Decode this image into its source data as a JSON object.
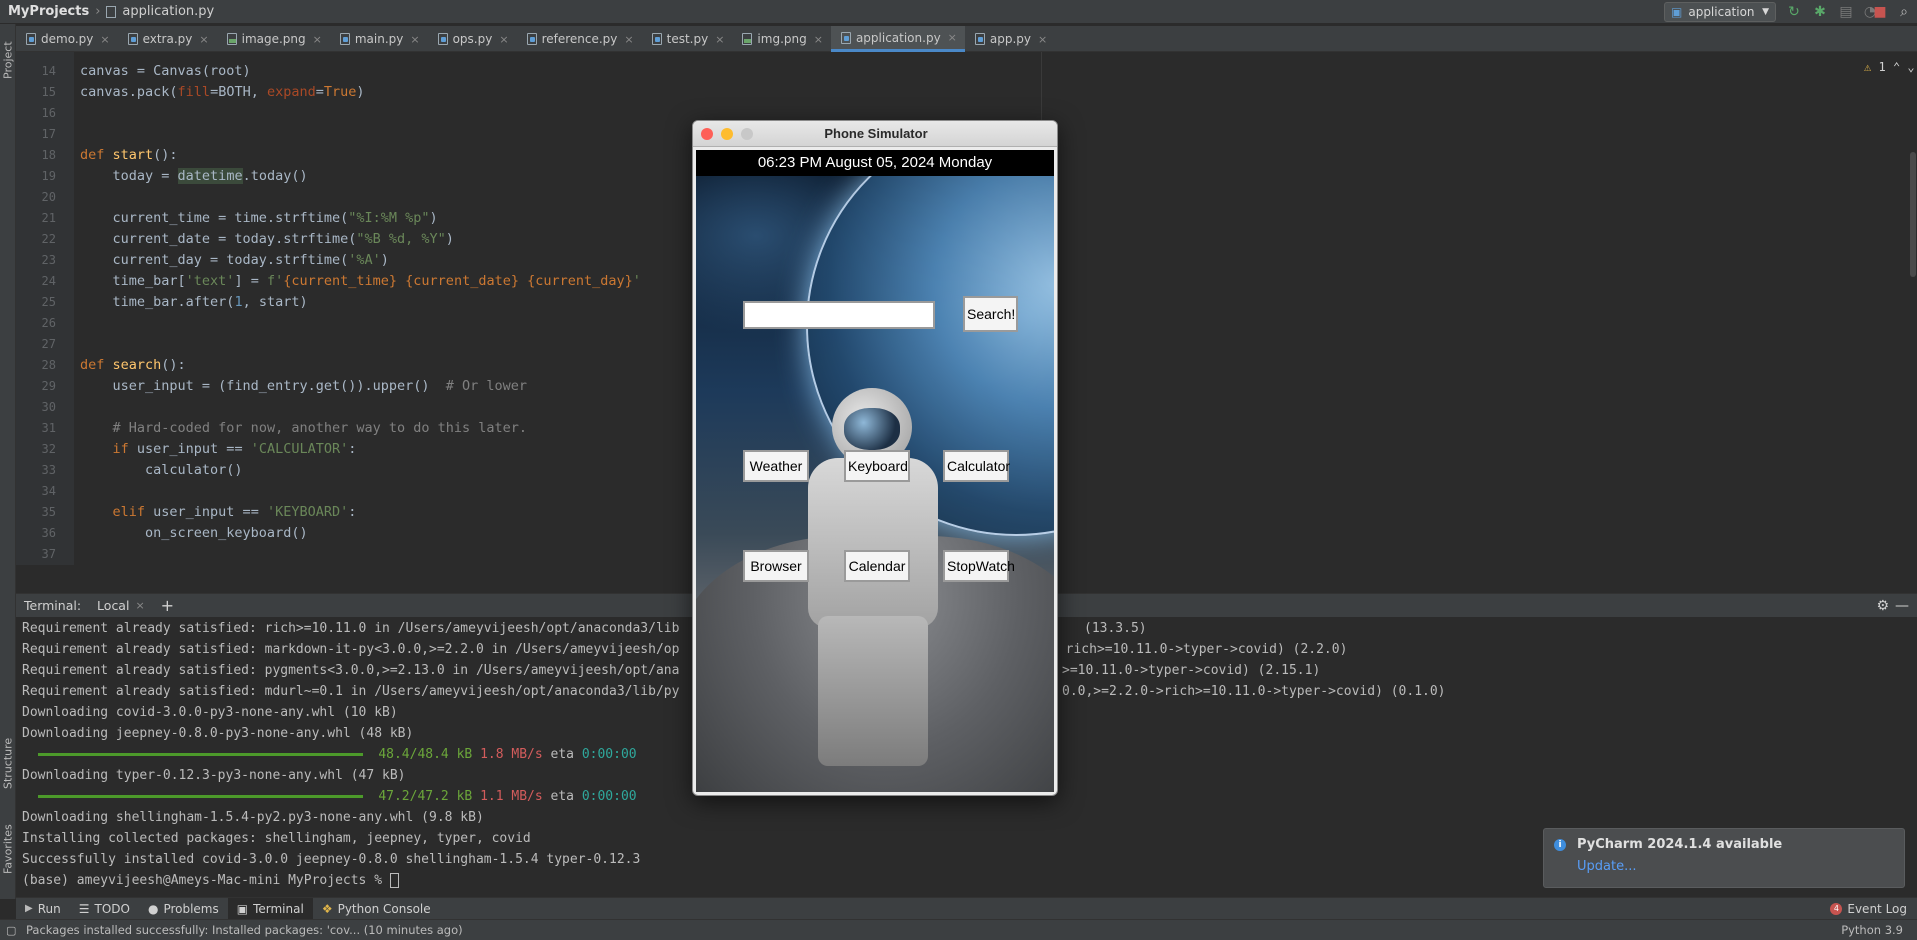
{
  "navbar": {
    "project": "MyProjects",
    "file": "application.py",
    "run_config": "application"
  },
  "left_stripe": {
    "project_label": "Project",
    "structure_label": "Structure",
    "favorites_label": "Favorites"
  },
  "tabs": [
    {
      "label": "demo.py",
      "icon": "python-file-icon"
    },
    {
      "label": "extra.py",
      "icon": "python-file-icon"
    },
    {
      "label": "image.png",
      "icon": "image-file-icon"
    },
    {
      "label": "main.py",
      "icon": "python-file-icon"
    },
    {
      "label": "ops.py",
      "icon": "python-file-icon"
    },
    {
      "label": "reference.py",
      "icon": "python-file-icon"
    },
    {
      "label": "test.py",
      "icon": "python-file-icon"
    },
    {
      "label": "img.png",
      "icon": "image-file-icon"
    },
    {
      "label": "application.py",
      "icon": "python-file-icon",
      "active": true
    },
    {
      "label": "app.py",
      "icon": "python-file-icon"
    }
  ],
  "editor": {
    "warning_count": "1",
    "line_numbers": [
      "14",
      "15",
      "16",
      "17",
      "18",
      "19",
      "20",
      "21",
      "22",
      "23",
      "24",
      "25",
      "26",
      "27",
      "28",
      "29",
      "30",
      "31",
      "32",
      "33",
      "34",
      "35",
      "36",
      "37"
    ]
  },
  "terminal": {
    "label": "Terminal:",
    "tab": "Local",
    "lines": {
      "l1": "Requirement already satisfied: rich>=10.11.0 in /Users/ameyvijeesh/opt/anaconda3/lib",
      "l1r": "(13.3.5)",
      "l2": "Requirement already satisfied: markdown-it-py<3.0.0,>=2.2.0 in /Users/ameyvijeesh/op",
      "l2r": "n rich>=10.11.0->typer->covid) (2.2.0)",
      "l3": "Requirement already satisfied: pygments<3.0.0,>=2.13.0 in /Users/ameyvijeesh/opt/ana",
      "l3r": ">=10.11.0->typer->covid) (2.15.1)",
      "l4": "Requirement already satisfied: mdurl~=0.1 in /Users/ameyvijeesh/opt/anaconda3/lib/py",
      "l4r": "0.0,>=2.2.0->rich>=10.11.0->typer->covid) (0.1.0)",
      "l5": "Downloading covid-3.0.0-py3-none-any.whl (10 kB)",
      "l6": "Downloading jeepney-0.8.0-py3-none-any.whl (48 kB)",
      "l7_size": "48.4/48.4 kB",
      "l7_speed": "1.8 MB/s",
      "l7_eta": "eta",
      "l7_time": "0:00:00",
      "l8": "Downloading typer-0.12.3-py3-none-any.whl (47 kB)",
      "l9_size": "47.2/47.2 kB",
      "l9_speed": "1.1 MB/s",
      "l9_eta": "eta",
      "l9_time": "0:00:00",
      "l10": "Downloading shellingham-1.5.4-py2.py3-none-any.whl (9.8 kB)",
      "l11": "Installing collected packages: shellingham, jeepney, typer, covid",
      "l12": "Successfully installed covid-3.0.0 jeepney-0.8.0 shellingham-1.5.4 typer-0.12.3",
      "prompt": "(base) ameyvijeesh@Ameys-Mac-mini MyProjects % "
    },
    "progress": [
      1.0,
      1.0
    ]
  },
  "toolwindows": {
    "run": "Run",
    "todo": "TODO",
    "problems": "Problems",
    "terminal": "Terminal",
    "python_console": "Python Console",
    "event_log": "Event Log",
    "event_count": "4"
  },
  "statusbar": {
    "message": "Packages installed successfully: Installed packages: 'cov... (10 minutes ago)",
    "interpreter": "Python 3.9"
  },
  "notification": {
    "title": "PyCharm 2024.1.4 available",
    "link": "Update..."
  },
  "simulator": {
    "title": "Phone Simulator",
    "time_bar": "06:23 PM August 05, 2024 Monday",
    "search_button": "Search!",
    "search_value": "",
    "apps": {
      "weather": "Weather",
      "keyboard": "Keyboard",
      "calculator": "Calculator",
      "browser": "Browser",
      "calendar": "Calendar",
      "stopwatch": "StopWatch"
    }
  },
  "colors": {
    "accent": "#4a88c7",
    "keyword": "#cc7832",
    "string": "#6a8759",
    "function": "#ffc66d"
  }
}
